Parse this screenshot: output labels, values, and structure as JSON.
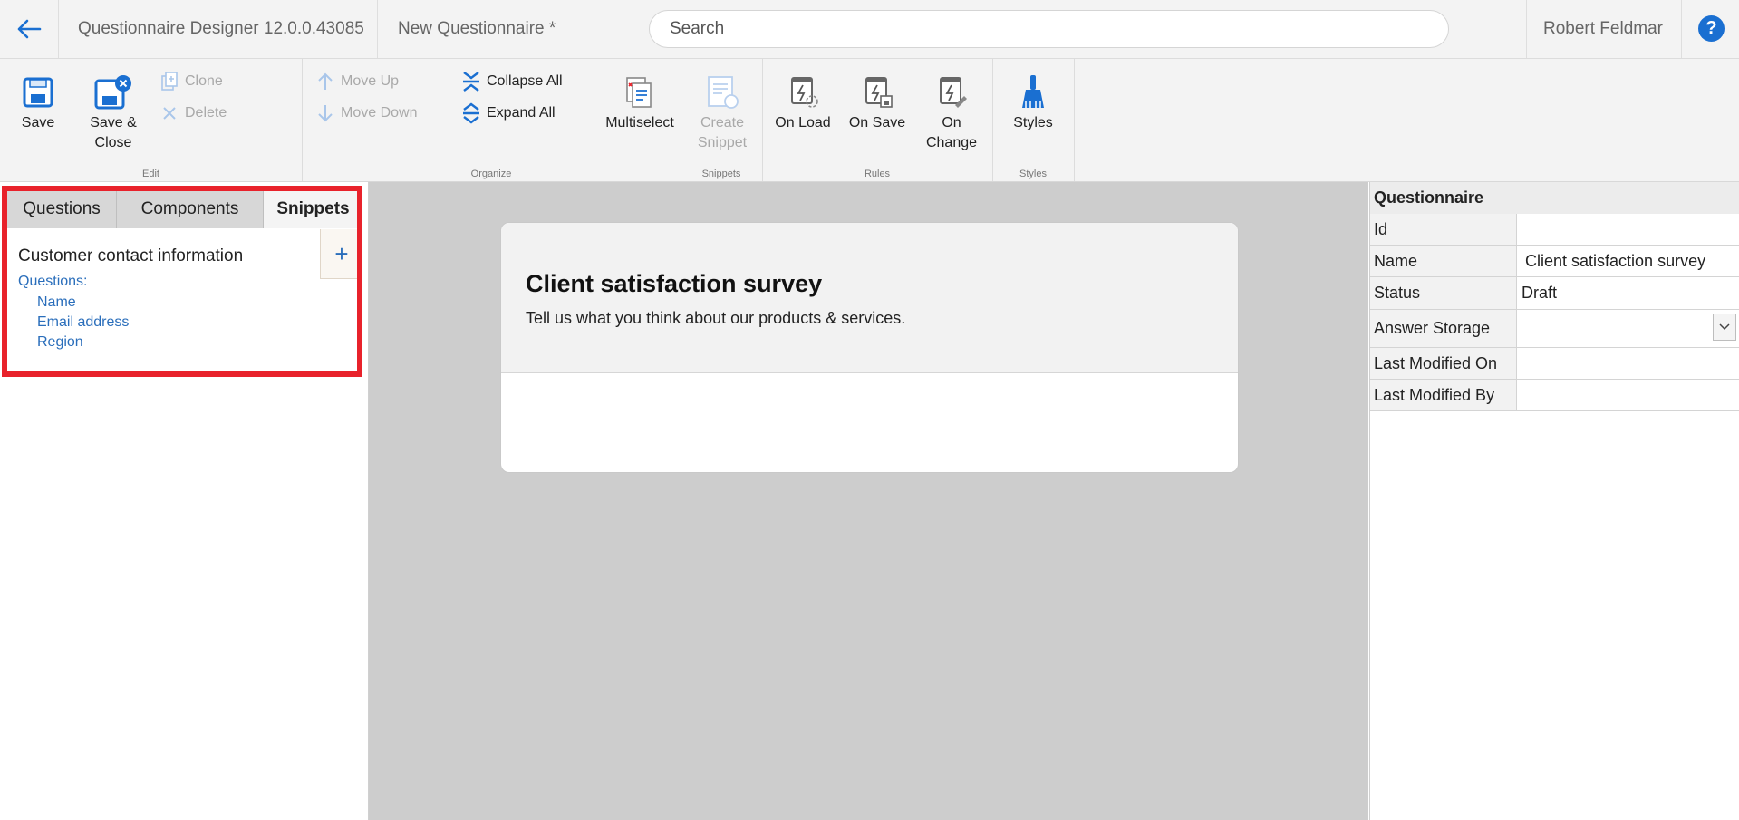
{
  "topbar": {
    "app_title": "Questionnaire Designer 12.0.0.43085",
    "doc_title": "New Questionnaire *",
    "search_placeholder": "Search",
    "user_name": "Robert Feldmar",
    "help_label": "?"
  },
  "ribbon": {
    "edit": {
      "label": "Edit",
      "save": "Save",
      "save_close_1": "Save &",
      "save_close_2": "Close",
      "clone": "Clone",
      "delete": "Delete"
    },
    "organize": {
      "label": "Organize",
      "move_up": "Move Up",
      "move_down": "Move Down",
      "collapse_all": "Collapse All",
      "expand_all": "Expand All",
      "multiselect": "Multiselect"
    },
    "snippets": {
      "label": "Snippets",
      "create_1": "Create",
      "create_2": "Snippet"
    },
    "rules": {
      "label": "Rules",
      "on_load": "On Load",
      "on_save": "On Save",
      "on_change_1": "On",
      "on_change_2": "Change"
    },
    "styles": {
      "label": "Styles",
      "styles": "Styles"
    }
  },
  "left_panel": {
    "tabs": [
      "Questions",
      "Components",
      "Snippets"
    ],
    "active_tab": "Snippets",
    "snippet": {
      "title": "Customer contact information",
      "questions_label": "Questions:",
      "questions": [
        "Name",
        "Email address",
        "Region"
      ]
    },
    "add_label": "+"
  },
  "canvas": {
    "title": "Client satisfaction survey",
    "subtitle": "Tell us what you think about our products & services."
  },
  "properties": {
    "header": "Questionnaire",
    "rows": [
      {
        "label": "Id",
        "value": ""
      },
      {
        "label": "Name",
        "value": "Client satisfaction survey"
      },
      {
        "label": "Status",
        "value": "Draft"
      },
      {
        "label": "Answer Storage",
        "value": ""
      },
      {
        "label": "Last Modified On",
        "value": ""
      },
      {
        "label": "Last Modified By",
        "value": ""
      }
    ]
  },
  "colors": {
    "accent": "#1a6fd1",
    "link": "#2a6ebb",
    "highlight": "#e8222b"
  }
}
